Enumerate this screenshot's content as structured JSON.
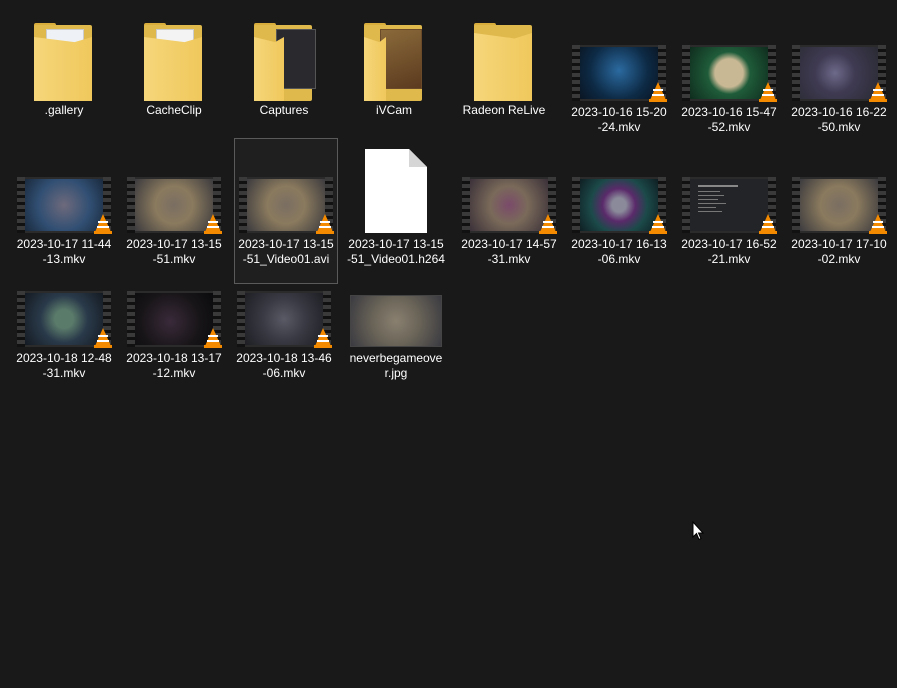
{
  "items": [
    {
      "label": ".gallery",
      "kind": "folder",
      "icon": "folder-icon"
    },
    {
      "label": "CacheClip",
      "kind": "folder",
      "icon": "folder-icon"
    },
    {
      "label": "Captures",
      "kind": "folder",
      "icon": "folder-icon"
    },
    {
      "label": "iVCam",
      "kind": "folder",
      "icon": "folder-icon"
    },
    {
      "label": "Radeon ReLive",
      "kind": "folder",
      "icon": "folder-icon"
    },
    {
      "label": "2023-10-16 15-20-24.mkv",
      "kind": "video"
    },
    {
      "label": "2023-10-16 15-47-52.mkv",
      "kind": "video"
    },
    {
      "label": "2023-10-16 16-22-50.mkv",
      "kind": "video"
    },
    {
      "label": "2023-10-17 11-44-13.mkv",
      "kind": "video"
    },
    {
      "label": "2023-10-17 13-15-51.mkv",
      "kind": "video"
    },
    {
      "label": "2023-10-17 13-15-51_Video01.avi",
      "kind": "video",
      "selected": true
    },
    {
      "label": "2023-10-17 13-15-51_Video01.h264",
      "kind": "file"
    },
    {
      "label": "2023-10-17 14-57-31.mkv",
      "kind": "video"
    },
    {
      "label": "2023-10-17 16-13-06.mkv",
      "kind": "video"
    },
    {
      "label": "2023-10-17 16-52-21.mkv",
      "kind": "video"
    },
    {
      "label": "2023-10-17 17-10-02.mkv",
      "kind": "video"
    },
    {
      "label": "2023-10-18 12-48-31.mkv",
      "kind": "video"
    },
    {
      "label": "2023-10-18 13-17-12.mkv",
      "kind": "video"
    },
    {
      "label": "2023-10-18 13-46-06.mkv",
      "kind": "video"
    },
    {
      "label": "neverbegameover.jpg",
      "kind": "image"
    }
  ],
  "colors": {
    "background": "#191919",
    "folder": "#f0c85c",
    "vlc_cone": "#f48a00",
    "selection_border": "#5a5a5a"
  }
}
